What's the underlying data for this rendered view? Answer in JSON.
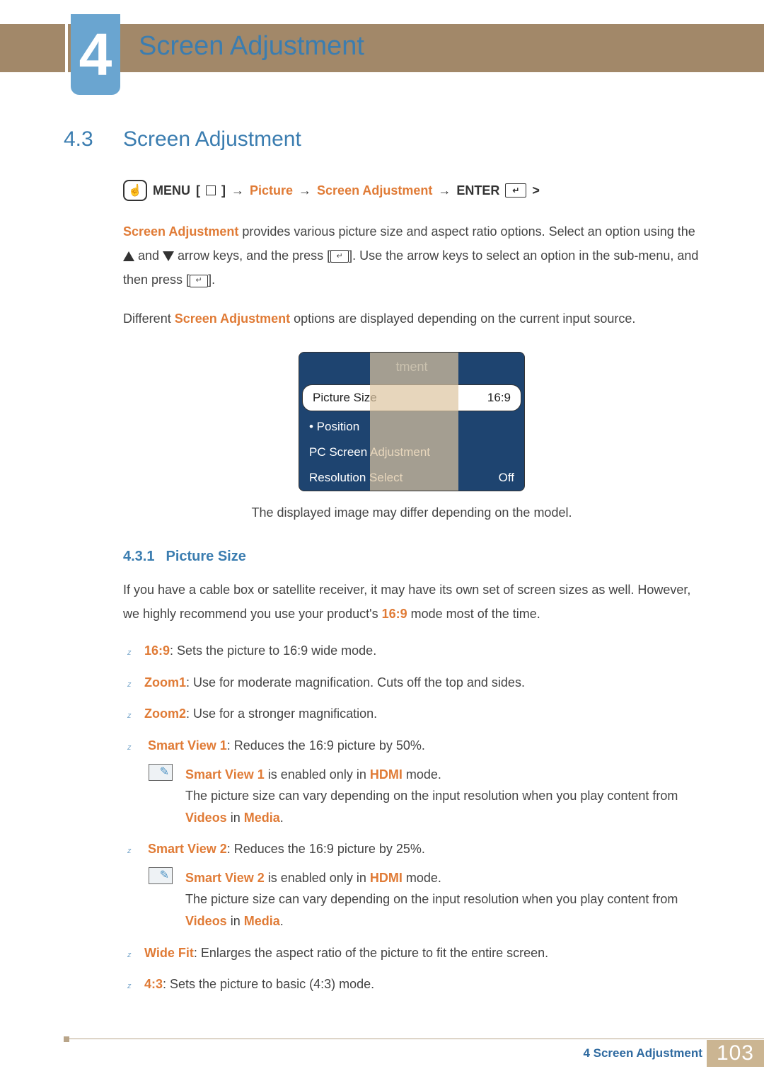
{
  "chapter": {
    "number": "4",
    "title": "Screen Adjustment"
  },
  "section": {
    "number": "4.3",
    "title": "Screen Adjustment"
  },
  "nav": {
    "menu": "MENU",
    "arrow": "→",
    "picture": "Picture",
    "screen_adj": "Screen Adjustment",
    "enter": "ENTER",
    "tail": ">"
  },
  "para1": {
    "lead": "Screen Adjustment",
    "a": " provides various picture size and aspect ratio options. Select an option using the ",
    "b": " and ",
    "c": " arrow keys, and the press [",
    "d": "]. Use the arrow keys to select an option in the sub-menu, and then press [",
    "e": "]."
  },
  "para2": {
    "a": "Different ",
    "hl": "Screen Adjustment",
    "b": " options are displayed depending on the current input source."
  },
  "menu": {
    "header_fragment": "tment",
    "rows": [
      {
        "label": "Picture Size",
        "value": "16:9",
        "selected": true
      },
      {
        "label": "• Position",
        "value": "",
        "selected": false
      },
      {
        "label": "PC Screen Adjustment",
        "value": "",
        "selected": false
      },
      {
        "label": "Resolution Select",
        "value": "Off",
        "selected": false
      }
    ]
  },
  "caption": "The displayed image may differ depending on the model.",
  "subsection": {
    "number": "4.3.1",
    "title": "Picture Size"
  },
  "intro": {
    "a": "If you have a cable box or satellite receiver, it may have its own set of screen sizes as well. However, we highly recommend you use your product's ",
    "hl": "16:9",
    "b": " mode most of the time."
  },
  "options": {
    "o1": {
      "name": "16:9",
      "desc": ": Sets the picture to 16:9 wide mode."
    },
    "o2": {
      "name": "Zoom1",
      "desc": ": Use for moderate magnification. Cuts off the top and sides."
    },
    "o3": {
      "name": "Zoom2",
      "desc": ": Use for a stronger magnification."
    },
    "o4": {
      "name": "Smart View 1",
      "desc": ": Reduces the 16:9 picture by 50%."
    },
    "o5": {
      "name": "Smart View 2",
      "desc": ": Reduces the 16:9 picture by 25%."
    },
    "o6": {
      "name": "Wide Fit",
      "desc": ": Enlarges the aspect ratio of the picture to fit the entire screen."
    },
    "o7": {
      "name": "4:3",
      "desc": ": Sets the picture to basic (4:3) mode."
    }
  },
  "note1": {
    "l1a": "Smart View 1",
    "l1b": " is enabled only in ",
    "l1c": "HDMI",
    "l1d": " mode.",
    "l2a": "The picture size can vary depending on the input resolution when you play content from ",
    "l2b": "Videos",
    "l2c": " in ",
    "l2d": "Media",
    "l2e": "."
  },
  "note2": {
    "l1a": "Smart View 2",
    "l1b": " is enabled only in ",
    "l1c": "HDMI",
    "l1d": " mode.",
    "l2a": "The picture size can vary depending on the input resolution when you play content from ",
    "l2b": "Videos",
    "l2c": " in ",
    "l2d": "Media",
    "l2e": "."
  },
  "footer": {
    "label": "4 Screen Adjustment",
    "page": "103"
  }
}
